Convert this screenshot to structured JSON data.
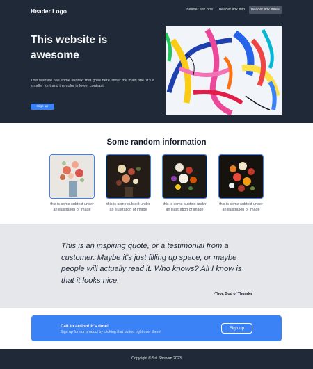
{
  "header": {
    "logo": "Header Logo",
    "nav": [
      "header link one",
      "header link two",
      "header link three"
    ]
  },
  "hero": {
    "title": "This website is awesome",
    "subtitle": "This website has some subtext that goes here under the main title. It's a smaller font and the color is lower contrast.",
    "button": "Sign up",
    "image": "abstract-colorful-painting"
  },
  "info": {
    "title": "Some random information",
    "cards": [
      {
        "text": "this is some subtext under an illustration of image",
        "image": "flower-vase-painting-light"
      },
      {
        "text": "this is some subtext under an illustration of image",
        "image": "flower-still-life-dark"
      },
      {
        "text": "this is some subtext under an illustration of image",
        "image": "flower-bouquet-dark"
      },
      {
        "text": "this is some subtext under an illustration of image",
        "image": "flower-arrangement-dark"
      }
    ]
  },
  "quote": {
    "text": "This is an inspiring quote, or a testimonial from a customer. Maybe it's just filling up space, or maybe people will actually read it. Who knows? All I know is that it looks nice.",
    "author": "-Thor, God of Thunder"
  },
  "cta": {
    "title": "Call to action! It's time!",
    "subtitle": "Sign up for our product by clicking that button right over there!",
    "button": "Sign up"
  },
  "footer": {
    "copyright": "Copyright © Sai Shravan 2023"
  },
  "colors": {
    "dark": "#1f2937",
    "accent": "#3b82f6",
    "light_gray": "#e5e7eb"
  }
}
